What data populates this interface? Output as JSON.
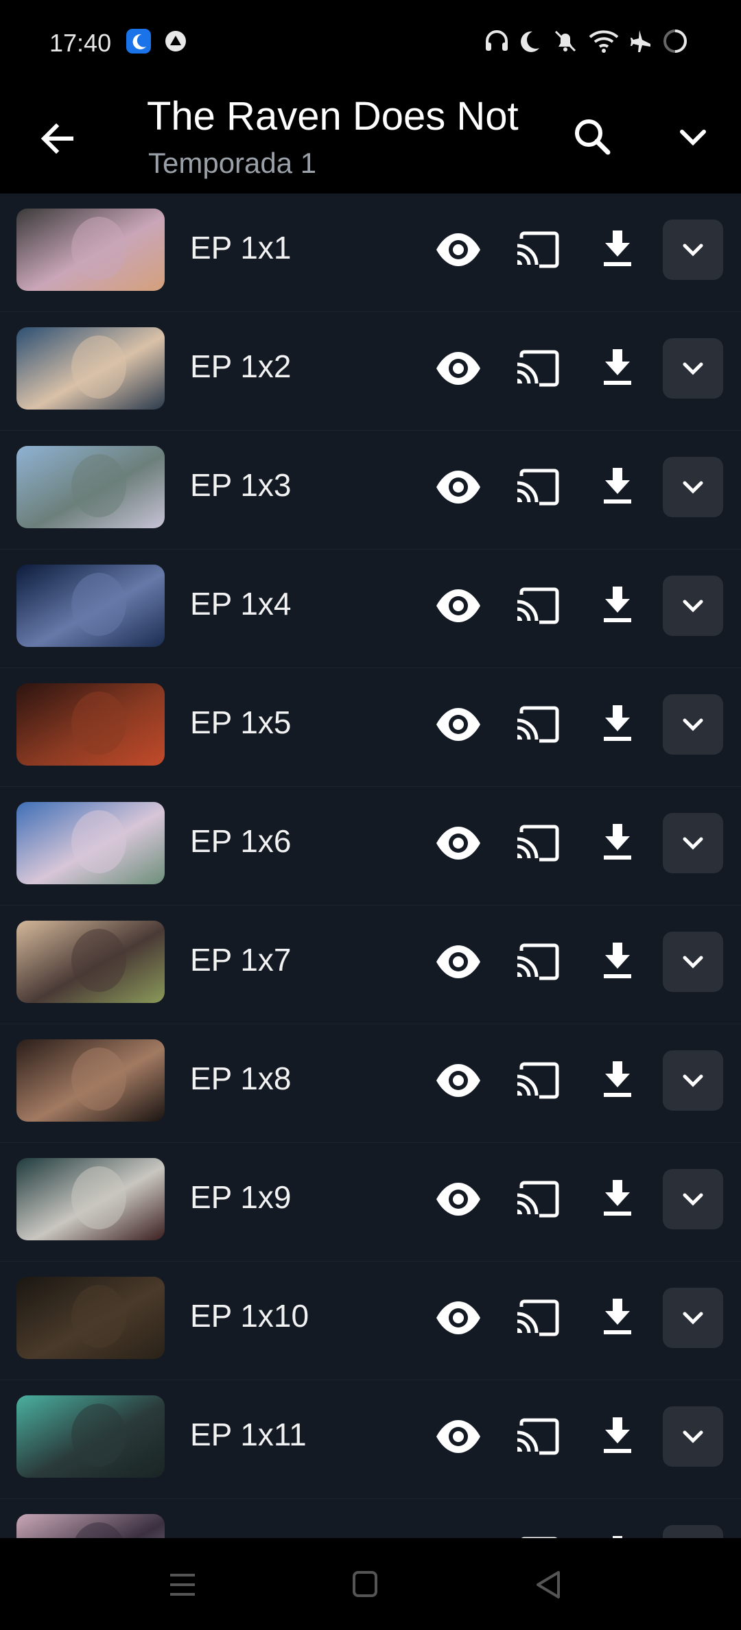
{
  "status_bar": {
    "time": "17:40",
    "left_icons": [
      "moon-badge-icon",
      "vpn-icon"
    ],
    "right_icons": [
      "headphones-icon",
      "do-not-disturb-icon",
      "muted-bell-icon",
      "wifi-icon",
      "airplane-icon",
      "battery-ring-icon"
    ]
  },
  "header": {
    "title": "The Raven Does Not",
    "subtitle": "Temporada 1",
    "back_icon": "arrow-back-icon",
    "search_icon": "search-icon",
    "menu_icon": "chevron-down-icon"
  },
  "episodes": [
    {
      "label": "EP 1x1",
      "thumb_colors": [
        "#3b3a3a",
        "#c9a6b8",
        "#d4a07b"
      ]
    },
    {
      "label": "EP 1x2",
      "thumb_colors": [
        "#2c4f73",
        "#d9c1a8",
        "#2b3a4d"
      ]
    },
    {
      "label": "EP 1x3",
      "thumb_colors": [
        "#8fb2d3",
        "#6c7f7a",
        "#c7c3d6"
      ]
    },
    {
      "label": "EP 1x4",
      "thumb_colors": [
        "#0c1c3d",
        "#6679a8",
        "#1c2d52"
      ]
    },
    {
      "label": "EP 1x5",
      "thumb_colors": [
        "#2c1410",
        "#8a3a22",
        "#c24a2a"
      ]
    },
    {
      "label": "EP 1x6",
      "thumb_colors": [
        "#3f6fb6",
        "#d7c6d8",
        "#6d8f7a"
      ]
    },
    {
      "label": "EP 1x7",
      "thumb_colors": [
        "#d3b89a",
        "#4a3a36",
        "#8a9a5a"
      ]
    },
    {
      "label": "EP 1x8",
      "thumb_colors": [
        "#2a1e1a",
        "#a27a62",
        "#1a1412"
      ]
    },
    {
      "label": "EP 1x9",
      "thumb_colors": [
        "#1f3b3d",
        "#c9c6c0",
        "#3b1f1f"
      ]
    },
    {
      "label": "EP 1x10",
      "thumb_colors": [
        "#1a1712",
        "#4a3a2a",
        "#2a2218"
      ]
    },
    {
      "label": "EP 1x11",
      "thumb_colors": [
        "#4ab0a0",
        "#2a3a3a",
        "#1a2424"
      ]
    },
    {
      "label": "",
      "thumb_colors": [
        "#c9a7b7",
        "#3a3040",
        "#9a8aa0"
      ]
    }
  ],
  "row_actions": [
    "eye-icon",
    "cast-icon",
    "download-icon",
    "chevron-down-icon"
  ],
  "nav_bar": [
    "recents-menu-icon",
    "home-square-icon",
    "back-triangle-icon"
  ],
  "colors": {
    "background": "#111520",
    "row": "#141a24",
    "expand_button": "#2a2f38",
    "subtitle": "#9aa0a8"
  }
}
